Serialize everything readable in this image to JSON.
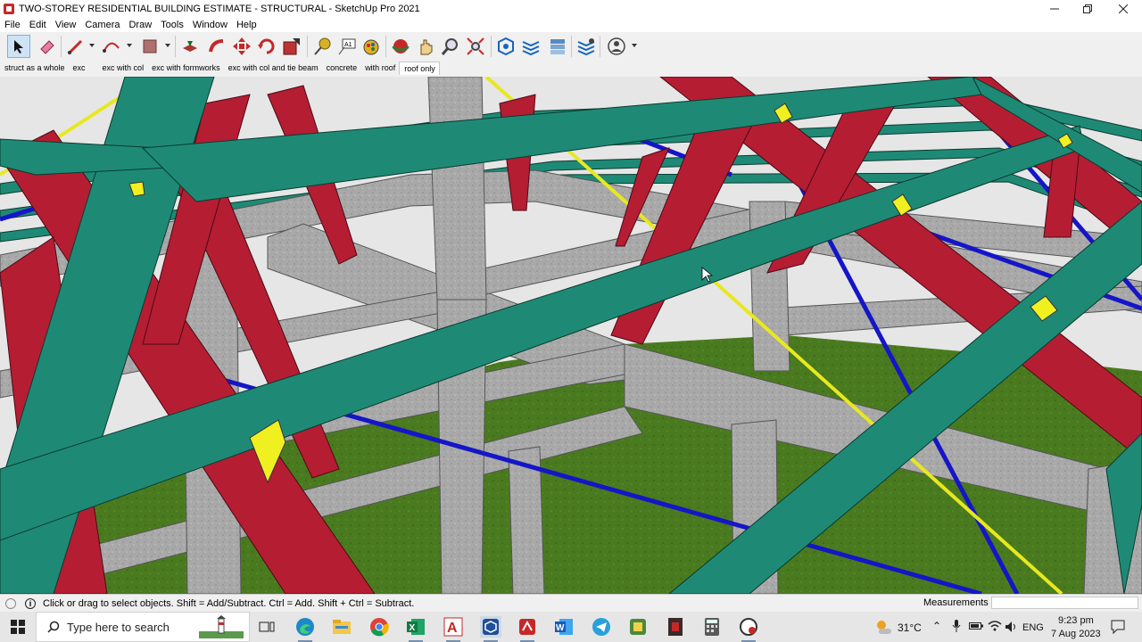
{
  "window": {
    "title": "TWO-STOREY RESIDENTIAL BUILDING ESTIMATE - STRUCTURAL - SketchUp Pro 2021",
    "minimize_icon": "minimize-icon",
    "maximize_icon": "restore-icon",
    "close_icon": "close-icon"
  },
  "menu": {
    "items": [
      "File",
      "Edit",
      "View",
      "Camera",
      "Draw",
      "Tools",
      "Window",
      "Help"
    ]
  },
  "toolbar": {
    "tools": [
      "select-icon",
      "eraser-icon",
      "line-icon",
      "arc-icon",
      "shape-icon",
      "push-pull-icon",
      "follow-me-icon",
      "move-icon",
      "rotate-icon",
      "scale-icon",
      "tape-measure-icon",
      "text-icon",
      "paint-bucket-icon",
      "orbit-icon",
      "pan-icon",
      "zoom-icon",
      "zoom-extents-icon",
      "warehouse-icon",
      "extension-warehouse-icon",
      "layout-icon",
      "extension-manager-icon",
      "account-icon"
    ]
  },
  "scenes": {
    "tabs": [
      "struct as a whole",
      "exc",
      "exc with col",
      "exc with formworks",
      "exc with col and tie beam",
      "concrete",
      "with roof",
      "roof only"
    ],
    "active_index": 7
  },
  "status": {
    "hint": "Click or drag to select objects. Shift = Add/Subtract. Ctrl = Add. Shift + Ctrl = Subtract.",
    "measurements_label": "Measurements",
    "measurements_value": ""
  },
  "taskbar": {
    "search_placeholder": "Type here to search",
    "apps": [
      "task-view-icon",
      "edge-icon",
      "file-explorer-icon",
      "chrome-icon",
      "excel-icon",
      "autocad-icon",
      "sketchup-icon",
      "sketchup-layout-icon",
      "word-icon",
      "telegram-icon",
      "app-icon",
      "video-icon",
      "calculator-icon",
      "screen-recorder-icon"
    ],
    "temperature": "31°C",
    "language": "ENG",
    "time": "9:23 pm",
    "date": "7 Aug 2023"
  },
  "colors": {
    "truss_green": "#1e8a76",
    "rafter_red": "#b51d33",
    "concrete_gray": "#a8a8a8",
    "ground_green": "#4a7a1f",
    "bracing_blue": "#1515c8",
    "bracing_yellow": "#e8e820"
  }
}
